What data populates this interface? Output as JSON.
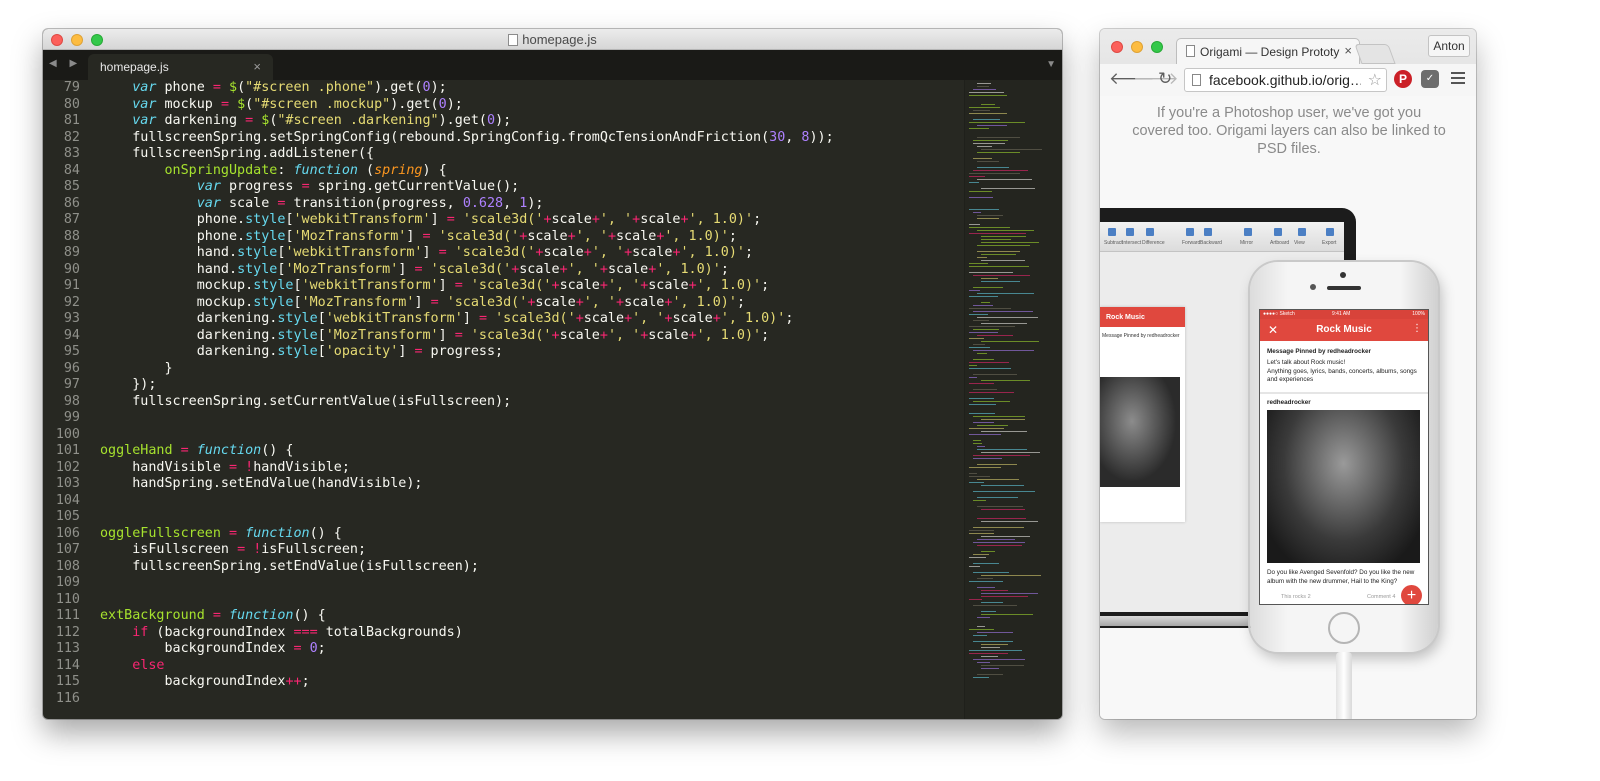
{
  "editor": {
    "window_title": "homepage.js",
    "tab_label": "homepage.js",
    "tab_close": "×",
    "nav_arrows": "◀ ▶",
    "menu_arrow": "▼",
    "lines": [
      {
        "n": "79",
        "t": [
          [
            "    ",
            ""
          ],
          [
            "var",
            "k"
          ],
          [
            " phone ",
            ""
          ],
          [
            "=",
            "o"
          ],
          [
            " ",
            ""
          ],
          [
            "$",
            "f"
          ],
          [
            "(",
            ""
          ],
          [
            "\"#screen .phone\"",
            "s"
          ],
          [
            ").get(",
            ""
          ],
          [
            "0",
            "n"
          ],
          [
            ");",
            ""
          ]
        ]
      },
      {
        "n": "80",
        "t": [
          [
            "    ",
            ""
          ],
          [
            "var",
            "k"
          ],
          [
            " mockup ",
            ""
          ],
          [
            "=",
            "o"
          ],
          [
            " ",
            ""
          ],
          [
            "$",
            "f"
          ],
          [
            "(",
            ""
          ],
          [
            "\"#screen .mockup\"",
            "s"
          ],
          [
            ").get(",
            ""
          ],
          [
            "0",
            "n"
          ],
          [
            ");",
            ""
          ]
        ]
      },
      {
        "n": "81",
        "t": [
          [
            "    ",
            ""
          ],
          [
            "var",
            "k"
          ],
          [
            " darkening ",
            ""
          ],
          [
            "=",
            "o"
          ],
          [
            " ",
            ""
          ],
          [
            "$",
            "f"
          ],
          [
            "(",
            ""
          ],
          [
            "\"#screen .darkening\"",
            "s"
          ],
          [
            ").get(",
            ""
          ],
          [
            "0",
            "n"
          ],
          [
            ");",
            ""
          ]
        ]
      },
      {
        "n": "82",
        "t": [
          [
            "    fullscreenSpring.setSpringConfig(rebound.SpringConfig.fromQcTensionAndFriction(",
            ""
          ],
          [
            "30",
            "n"
          ],
          [
            ", ",
            ""
          ],
          [
            "8",
            "n"
          ],
          [
            "));",
            ""
          ]
        ]
      },
      {
        "n": "83",
        "t": [
          [
            "    fullscreenSpring.addListener({",
            ""
          ]
        ]
      },
      {
        "n": "84",
        "t": [
          [
            "        ",
            ""
          ],
          [
            "onSpringUpdate",
            "f"
          ],
          [
            ": ",
            ""
          ],
          [
            "function",
            "k"
          ],
          [
            " (",
            ""
          ],
          [
            "spring",
            "p"
          ],
          [
            ") {",
            ""
          ]
        ]
      },
      {
        "n": "85",
        "t": [
          [
            "            ",
            ""
          ],
          [
            "var",
            "k"
          ],
          [
            " progress ",
            ""
          ],
          [
            "=",
            "o"
          ],
          [
            " spring.getCurrentValue();",
            ""
          ]
        ]
      },
      {
        "n": "86",
        "t": [
          [
            "            ",
            ""
          ],
          [
            "var",
            "k"
          ],
          [
            " scale ",
            ""
          ],
          [
            "=",
            "o"
          ],
          [
            " transition(progress, ",
            ""
          ],
          [
            "0.628",
            "n"
          ],
          [
            ", ",
            ""
          ],
          [
            "1",
            "n"
          ],
          [
            ");",
            ""
          ]
        ]
      },
      {
        "n": "87",
        "t": [
          [
            "            phone.",
            ""
          ],
          [
            "style",
            "b"
          ],
          [
            "[",
            ""
          ],
          [
            "'webkitTransform'",
            "s"
          ],
          [
            "] ",
            ""
          ],
          [
            "=",
            "o"
          ],
          [
            " ",
            ""
          ],
          [
            "'scale3d('",
            "s"
          ],
          [
            "+",
            "o"
          ],
          [
            "scale",
            ""
          ],
          [
            "+",
            "o"
          ],
          [
            "', '",
            "s"
          ],
          [
            "+",
            "o"
          ],
          [
            "scale",
            ""
          ],
          [
            "+",
            "o"
          ],
          [
            "', 1.0)'",
            "s"
          ],
          [
            ";",
            ""
          ]
        ]
      },
      {
        "n": "88",
        "t": [
          [
            "            phone.",
            ""
          ],
          [
            "style",
            "b"
          ],
          [
            "[",
            ""
          ],
          [
            "'MozTransform'",
            "s"
          ],
          [
            "] ",
            ""
          ],
          [
            "=",
            "o"
          ],
          [
            " ",
            ""
          ],
          [
            "'scale3d('",
            "s"
          ],
          [
            "+",
            "o"
          ],
          [
            "scale",
            ""
          ],
          [
            "+",
            "o"
          ],
          [
            "', '",
            "s"
          ],
          [
            "+",
            "o"
          ],
          [
            "scale",
            ""
          ],
          [
            "+",
            "o"
          ],
          [
            "', 1.0)'",
            "s"
          ],
          [
            ";",
            ""
          ]
        ]
      },
      {
        "n": "89",
        "t": [
          [
            "            hand.",
            ""
          ],
          [
            "style",
            "b"
          ],
          [
            "[",
            ""
          ],
          [
            "'webkitTransform'",
            "s"
          ],
          [
            "] ",
            ""
          ],
          [
            "=",
            "o"
          ],
          [
            " ",
            ""
          ],
          [
            "'scale3d('",
            "s"
          ],
          [
            "+",
            "o"
          ],
          [
            "scale",
            ""
          ],
          [
            "+",
            "o"
          ],
          [
            "', '",
            "s"
          ],
          [
            "+",
            "o"
          ],
          [
            "scale",
            ""
          ],
          [
            "+",
            "o"
          ],
          [
            "', 1.0)'",
            "s"
          ],
          [
            ";",
            ""
          ]
        ]
      },
      {
        "n": "90",
        "t": [
          [
            "            hand.",
            ""
          ],
          [
            "style",
            "b"
          ],
          [
            "[",
            ""
          ],
          [
            "'MozTransform'",
            "s"
          ],
          [
            "] ",
            ""
          ],
          [
            "=",
            "o"
          ],
          [
            " ",
            ""
          ],
          [
            "'scale3d('",
            "s"
          ],
          [
            "+",
            "o"
          ],
          [
            "scale",
            ""
          ],
          [
            "+",
            "o"
          ],
          [
            "', '",
            "s"
          ],
          [
            "+",
            "o"
          ],
          [
            "scale",
            ""
          ],
          [
            "+",
            "o"
          ],
          [
            "', 1.0)'",
            "s"
          ],
          [
            ";",
            ""
          ]
        ]
      },
      {
        "n": "91",
        "t": [
          [
            "            mockup.",
            ""
          ],
          [
            "style",
            "b"
          ],
          [
            "[",
            ""
          ],
          [
            "'webkitTransform'",
            "s"
          ],
          [
            "] ",
            ""
          ],
          [
            "=",
            "o"
          ],
          [
            " ",
            ""
          ],
          [
            "'scale3d('",
            "s"
          ],
          [
            "+",
            "o"
          ],
          [
            "scale",
            ""
          ],
          [
            "+",
            "o"
          ],
          [
            "', '",
            "s"
          ],
          [
            "+",
            "o"
          ],
          [
            "scale",
            ""
          ],
          [
            "+",
            "o"
          ],
          [
            "', 1.0)'",
            "s"
          ],
          [
            ";",
            ""
          ]
        ]
      },
      {
        "n": "92",
        "t": [
          [
            "            mockup.",
            ""
          ],
          [
            "style",
            "b"
          ],
          [
            "[",
            ""
          ],
          [
            "'MozTransform'",
            "s"
          ],
          [
            "] ",
            ""
          ],
          [
            "=",
            "o"
          ],
          [
            " ",
            ""
          ],
          [
            "'scale3d('",
            "s"
          ],
          [
            "+",
            "o"
          ],
          [
            "scale",
            ""
          ],
          [
            "+",
            "o"
          ],
          [
            "', '",
            "s"
          ],
          [
            "+",
            "o"
          ],
          [
            "scale",
            ""
          ],
          [
            "+",
            "o"
          ],
          [
            "', 1.0)'",
            "s"
          ],
          [
            ";",
            ""
          ]
        ]
      },
      {
        "n": "93",
        "t": [
          [
            "            darkening.",
            ""
          ],
          [
            "style",
            "b"
          ],
          [
            "[",
            ""
          ],
          [
            "'webkitTransform'",
            "s"
          ],
          [
            "] ",
            ""
          ],
          [
            "=",
            "o"
          ],
          [
            " ",
            ""
          ],
          [
            "'scale3d('",
            "s"
          ],
          [
            "+",
            "o"
          ],
          [
            "scale",
            ""
          ],
          [
            "+",
            "o"
          ],
          [
            "', '",
            "s"
          ],
          [
            "+",
            "o"
          ],
          [
            "scale",
            ""
          ],
          [
            "+",
            "o"
          ],
          [
            "', 1.0)'",
            "s"
          ],
          [
            ";",
            ""
          ]
        ]
      },
      {
        "n": "94",
        "t": [
          [
            "            darkening.",
            ""
          ],
          [
            "style",
            "b"
          ],
          [
            "[",
            ""
          ],
          [
            "'MozTransform'",
            "s"
          ],
          [
            "] ",
            ""
          ],
          [
            "=",
            "o"
          ],
          [
            " ",
            ""
          ],
          [
            "'scale3d('",
            "s"
          ],
          [
            "+",
            "o"
          ],
          [
            "scale",
            ""
          ],
          [
            "+",
            "o"
          ],
          [
            "', '",
            "s"
          ],
          [
            "+",
            "o"
          ],
          [
            "scale",
            ""
          ],
          [
            "+",
            "o"
          ],
          [
            "', 1.0)'",
            "s"
          ],
          [
            ";",
            ""
          ]
        ]
      },
      {
        "n": "95",
        "t": [
          [
            "            darkening.",
            ""
          ],
          [
            "style",
            "b"
          ],
          [
            "[",
            ""
          ],
          [
            "'opacity'",
            "s"
          ],
          [
            "] ",
            ""
          ],
          [
            "=",
            "o"
          ],
          [
            " progress;",
            ""
          ]
        ]
      },
      {
        "n": "96",
        "t": [
          [
            "        }",
            ""
          ]
        ]
      },
      {
        "n": "97",
        "t": [
          [
            "    });",
            ""
          ]
        ]
      },
      {
        "n": "98",
        "t": [
          [
            "    fullscreenSpring.setCurrentValue(isFullscreen);",
            ""
          ]
        ]
      },
      {
        "n": "99",
        "t": []
      },
      {
        "n": "100",
        "t": []
      },
      {
        "n": "101",
        "t": [
          [
            "oggleHand ",
            "f"
          ],
          [
            "=",
            "o"
          ],
          [
            " ",
            ""
          ],
          [
            "function",
            "k"
          ],
          [
            "() {",
            ""
          ]
        ]
      },
      {
        "n": "102",
        "t": [
          [
            "    handVisible ",
            ""
          ],
          [
            "=",
            "o"
          ],
          [
            " ",
            ""
          ],
          [
            "!",
            "o"
          ],
          [
            "handVisible;",
            ""
          ]
        ]
      },
      {
        "n": "103",
        "t": [
          [
            "    handSpring.setEndValue(handVisible);",
            ""
          ]
        ]
      },
      {
        "n": "104",
        "t": []
      },
      {
        "n": "105",
        "t": []
      },
      {
        "n": "106",
        "t": [
          [
            "oggleFullscreen ",
            "f"
          ],
          [
            "=",
            "o"
          ],
          [
            " ",
            ""
          ],
          [
            "function",
            "k"
          ],
          [
            "() {",
            ""
          ]
        ]
      },
      {
        "n": "107",
        "t": [
          [
            "    isFullscreen ",
            ""
          ],
          [
            "=",
            "o"
          ],
          [
            " ",
            ""
          ],
          [
            "!",
            "o"
          ],
          [
            "isFullscreen;",
            ""
          ]
        ]
      },
      {
        "n": "108",
        "t": [
          [
            "    fullscreenSpring.setEndValue(isFullscreen);",
            ""
          ]
        ]
      },
      {
        "n": "109",
        "t": []
      },
      {
        "n": "110",
        "t": []
      },
      {
        "n": "111",
        "t": [
          [
            "extBackground ",
            "f"
          ],
          [
            "=",
            "o"
          ],
          [
            " ",
            ""
          ],
          [
            "function",
            "k"
          ],
          [
            "() {",
            ""
          ]
        ]
      },
      {
        "n": "112",
        "t": [
          [
            "    ",
            ""
          ],
          [
            "if",
            "o"
          ],
          [
            " (backgroundIndex ",
            ""
          ],
          [
            "===",
            "o"
          ],
          [
            " totalBackgrounds)",
            ""
          ]
        ]
      },
      {
        "n": "113",
        "t": [
          [
            "        backgroundIndex ",
            ""
          ],
          [
            "=",
            "o"
          ],
          [
            " ",
            ""
          ],
          [
            "0",
            "n"
          ],
          [
            ";",
            ""
          ]
        ]
      },
      {
        "n": "114",
        "t": [
          [
            "    ",
            ""
          ],
          [
            "else",
            "o"
          ]
        ]
      },
      {
        "n": "115",
        "t": [
          [
            "        backgroundIndex",
            ""
          ],
          [
            "++",
            "o"
          ],
          [
            ";",
            ""
          ]
        ]
      },
      {
        "n": "116",
        "t": []
      }
    ]
  },
  "browser": {
    "tab_title": "Origami — Design Prototyp",
    "tab_close": "×",
    "user": "Anton",
    "url": "facebook.github.io/orig…",
    "intro_text": "If you're a Photoshop user, we've got you covered too. Origami layers can also be linked to PSD files.",
    "laptop": {
      "toolbar_items": [
        "Subtract",
        "Intersect",
        "Difference",
        "Forward",
        "Backward",
        "Mirror",
        "Artboard",
        "View",
        "Export"
      ],
      "artboard_title": "Rock Music",
      "artboard_text": "Message Pinned by redheadrocker"
    },
    "phone": {
      "status_left": "●●●●○ Sketch",
      "status_time": "9:41 AM",
      "status_battery": "100%",
      "close": "✕",
      "title": "Rock Music",
      "more": "⋮",
      "pinned_title": "Message Pinned by redheadrocker",
      "pinned_line1": "Let's talk about Rock music!",
      "pinned_line2": "Anything goes, lyrics, bands, concerts, albums, songs and experiences",
      "post_user": "redheadrocker",
      "caption": "Do you like Avenged Sevenfold? Do you like the new album with the new drummer, Hail to the King?",
      "action_rocks": "This rocks  2",
      "action_comment": "Comment  4",
      "fab": "+"
    }
  },
  "colors": {
    "editor_bg": "#272822",
    "keyword": "#66d9ef",
    "operator": "#f92672",
    "string": "#e6db74",
    "number": "#ae81ff",
    "function": "#a6e22e",
    "app_red": "#e0483e"
  }
}
